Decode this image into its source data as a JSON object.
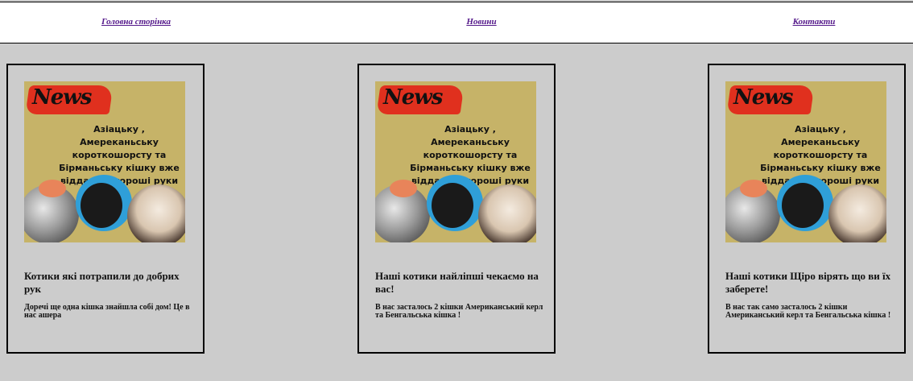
{
  "nav": {
    "home": "Головна сторінка",
    "news": "Новини",
    "contacts": "Контакти"
  },
  "thumbnail": {
    "logo": "News",
    "caption": "Азіацьку , Амереканьську короткошорсту та Бірманьську кішку вже віддали у хороші руки"
  },
  "cards": [
    {
      "title": "Котики які потрапили до добрих рук",
      "text": "Доречі ще одна кішка знайшла собі дом! Це в нас ашера"
    },
    {
      "title": "Наші котики найліпші чекаємо на вас!",
      "text": "В нас засталось 2 кішки Американський керл та Бенгальська кішка !"
    },
    {
      "title": "Наші котики Щіро вірять що ви їх заберете!",
      "text": "В нас так само засталось 2 кішки Американський керл та Бенгальська кішка !"
    }
  ],
  "colors": {
    "page_background": "#cccccc",
    "thumbnail_background": "#c6b368",
    "logo_red": "#e0301e",
    "link": "#551a8b"
  }
}
